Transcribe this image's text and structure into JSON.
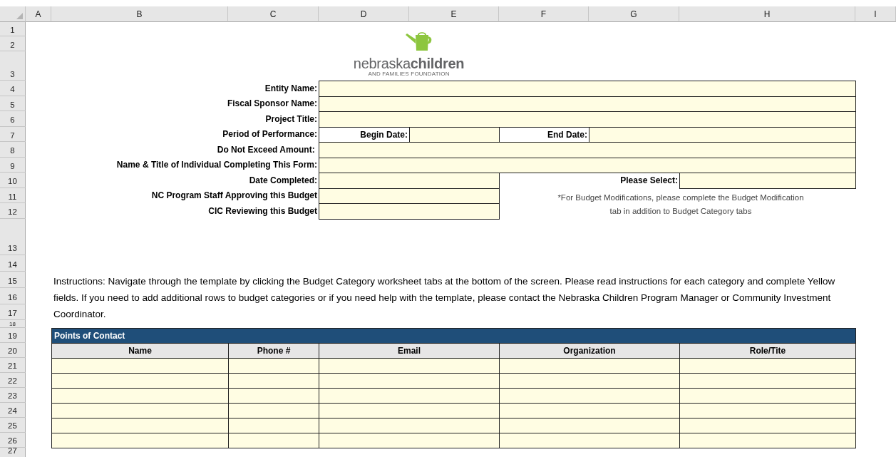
{
  "sheet": {
    "column_headers": [
      "A",
      "B",
      "C",
      "D",
      "E",
      "F",
      "G",
      "H",
      "I"
    ],
    "row_headers": [
      "1",
      "2",
      "3",
      "4",
      "5",
      "6",
      "7",
      "8",
      "9",
      "10",
      "11",
      "12",
      "13",
      "14",
      "15",
      "16",
      "17",
      "18",
      "19",
      "20",
      "21",
      "22",
      "23",
      "24",
      "25",
      "26",
      "27"
    ]
  },
  "logo": {
    "word_light": "nebraska",
    "word_bold": "children",
    "tagline": "AND FAMILIES FOUNDATION"
  },
  "form_fields": [
    {
      "label": "Entity Name:",
      "kind": "wide"
    },
    {
      "label": "Fiscal Sponsor Name:",
      "kind": "wide"
    },
    {
      "label": "Project Title:",
      "kind": "wide"
    },
    {
      "label": "Period of Performance:",
      "kind": "dates",
      "begin_label": "Begin Date:",
      "end_label": "End Date:"
    },
    {
      "label": "Do Not Exceed Amount: ",
      "kind": "wide"
    },
    {
      "label": "Name & Title of Individual Completing This Form:",
      "kind": "wide"
    },
    {
      "label": "Date Completed:",
      "kind": "select",
      "select_label": "Please Select:"
    },
    {
      "label": "NC Program Staff Approving this Budget",
      "kind": "half"
    },
    {
      "label": "CIC Reviewing this Budget",
      "kind": "half"
    }
  ],
  "note": "*For Budget Modifications, please complete the Budget Modification tab in addition to Budget Category tabs",
  "instructions": "Instructions: Navigate through the template by clicking the Budget Category worksheet tabs at the bottom of the screen. Please read instructions for each category and complete Yellow fields. If you need to add additional rows to budget categories or if you need help with the template, please contact the Nebraska Children Program Manager or Community Investment Coordinator.",
  "contacts": {
    "title": "Points of Contact",
    "columns": [
      "Name",
      "Phone #",
      "Email",
      "Organization",
      "Role/Tite"
    ],
    "rows": [
      {
        "kind": "blank"
      },
      {
        "kind": "blank"
      },
      {
        "kind": "blank"
      },
      {
        "kind": "blank"
      },
      {
        "kind": "blank"
      },
      {
        "kind": "blank"
      }
    ]
  }
}
